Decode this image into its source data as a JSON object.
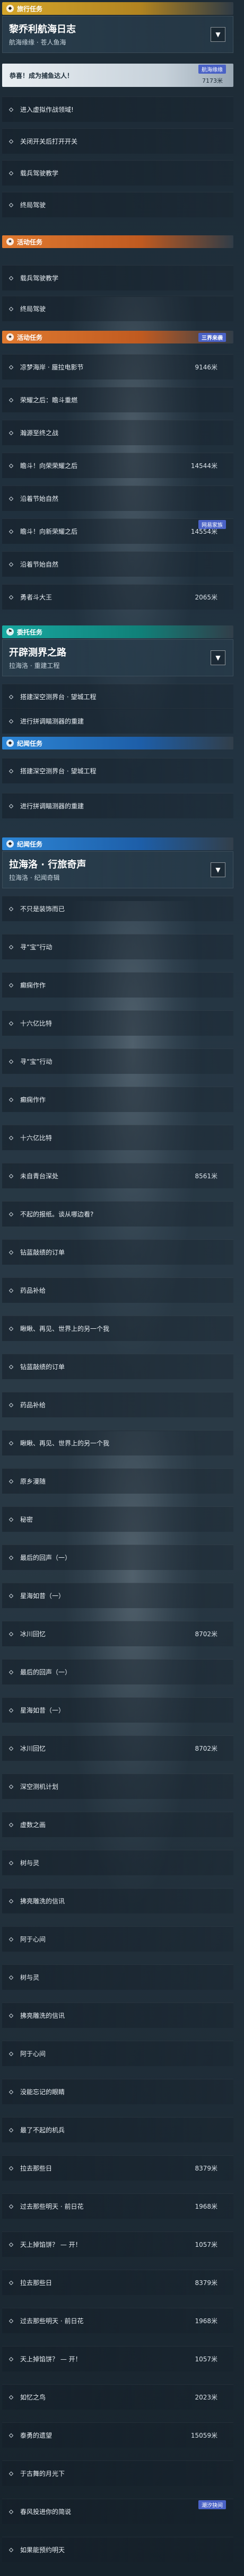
{
  "colors": {
    "yellow": "#d4a52a",
    "orange": "#e07a30",
    "teal": "#18a8a0",
    "blue": "#2d86d6",
    "tag": "#4a62c6",
    "pin": "#e0506a"
  },
  "section1": {
    "title": "旅行任务",
    "icon": "compass-icon"
  },
  "quest1": {
    "title": "黎乔利航海日志",
    "sub": "航海缘缘 · 苍人鱼海"
  },
  "hl1": {
    "text": "恭喜！成为捕鱼达人！",
    "tag": "航海缘缘",
    "sub": "7173米"
  },
  "s1rows": [
    "进入虚拟作战领域!",
    "关闭开关后打开开关",
    "载兵驾驶教学",
    "终局驾驶"
  ],
  "section2": {
    "title": "活动任务"
  },
  "s2rows": [
    "载兵驾驶教学",
    "终局驾驶"
  ],
  "section3": {
    "title": "活动任务",
    "tag": "三界来袭"
  },
  "s3rows": [
    {
      "label": "凉梦海岸 · 蜃拉电影节",
      "dist": "9146米"
    },
    {
      "label": "荣耀之后：瞻斗重燃",
      "dist": ""
    },
    {
      "label": "瀚源至终之战",
      "dist": ""
    },
    {
      "label": "瞻斗！向荣荣耀之后",
      "dist": "14544米"
    },
    {
      "label": "沿着节始自然",
      "dist": ""
    },
    {
      "label": "瞻斗！向新荣耀之后",
      "dist": "14554米",
      "tag": "网易家族"
    },
    {
      "label": "沿着节始自然",
      "dist": ""
    },
    {
      "label": "勇者斗大王",
      "dist": "2065米"
    }
  ],
  "section4": {
    "title": "委托任务"
  },
  "quest2": {
    "title": "开辟测界之路",
    "sub": "拉海洛 · 重建工程"
  },
  "s4rows": [
    "搭建深空测界台 · 望城工程",
    "进行拼调瞄测器的重建"
  ],
  "section5": {
    "title": "纪闻任务"
  },
  "s5rows": [
    "搭建深空测界台 · 望城工程",
    "进行拼调瞄测器的重建"
  ],
  "section6": {
    "title": "纪闻任务"
  },
  "quest3": {
    "title": "拉海洛 · 行旅奇声",
    "sub": "拉海洛 · 纪闻奇辑"
  },
  "s6rows": [
    {
      "label": "不只是装饰而已",
      "dist": ""
    },
    {
      "label": "寻“宝”行动",
      "dist": ""
    },
    {
      "label": "癫痫作作",
      "dist": ""
    },
    {
      "label": "十六亿比特",
      "dist": ""
    },
    {
      "label": "寻“宝”行动",
      "dist": ""
    },
    {
      "label": "癫痫作作",
      "dist": ""
    },
    {
      "label": "十六亿比特",
      "dist": ""
    },
    {
      "label": "未自青台深处",
      "dist": "8561米"
    },
    {
      "label": "不起的报纸。谈从哪边看?",
      "dist": ""
    },
    {
      "label": "钻蓝敲绩的订单",
      "dist": ""
    },
    {
      "label": "药品补给",
      "dist": ""
    },
    {
      "label": "瞅瞅、再见、世界上的另一个我",
      "dist": ""
    },
    {
      "label": "钻蓝敲绩的订单",
      "dist": ""
    },
    {
      "label": "药品补给",
      "dist": ""
    },
    {
      "label": "瞅瞅、再见、世界上的另一个我",
      "dist": ""
    },
    {
      "label": "原乡漫随",
      "dist": ""
    },
    {
      "label": "秘密",
      "dist": ""
    },
    {
      "label": "最后的回声（一）",
      "dist": ""
    },
    {
      "label": "星海如昔（一）",
      "dist": ""
    },
    {
      "label": "冰川回忆",
      "dist": "8702米"
    },
    {
      "label": "最后的回声（一）",
      "dist": ""
    },
    {
      "label": "星海如昔（一）",
      "dist": ""
    },
    {
      "label": "冰川回忆",
      "dist": "8702米"
    },
    {
      "label": "深空测机计划",
      "dist": ""
    },
    {
      "label": "虚数之画",
      "dist": ""
    },
    {
      "label": "树与灵",
      "dist": ""
    },
    {
      "label": "拂亮雕洗的信讯",
      "dist": ""
    },
    {
      "label": "阿于心间",
      "dist": ""
    },
    {
      "label": "树与灵",
      "dist": ""
    },
    {
      "label": "拂亮雕洗的信讯",
      "dist": ""
    },
    {
      "label": "阿于心间",
      "dist": ""
    },
    {
      "label": "没能忘记的眼睛",
      "dist": ""
    },
    {
      "label": "最了不起的机兵",
      "dist": ""
    },
    {
      "label": "拉去那些日",
      "dist": "8379米"
    },
    {
      "label": "过去那些明天 · 前日花",
      "dist": "1968米"
    },
    {
      "label": "天上掉馅饼？ — 开！",
      "dist": "1057米"
    },
    {
      "label": "拉去那些日",
      "dist": "8379米"
    },
    {
      "label": "过去那些明天 · 前日花",
      "dist": "1968米"
    },
    {
      "label": "天上掉馅饼？ — 开！",
      "dist": "1057米"
    },
    {
      "label": "如忆之鸟",
      "dist": "2023米"
    },
    {
      "label": "泰勇的遗望",
      "dist": "15059米"
    },
    {
      "label": "于古舞的月光下",
      "dist": ""
    },
    {
      "label": "春风投进你的简说",
      "dist": "",
      "tag": "潮汐抉间"
    },
    {
      "label": "如果能预约明天",
      "dist": ""
    }
  ]
}
